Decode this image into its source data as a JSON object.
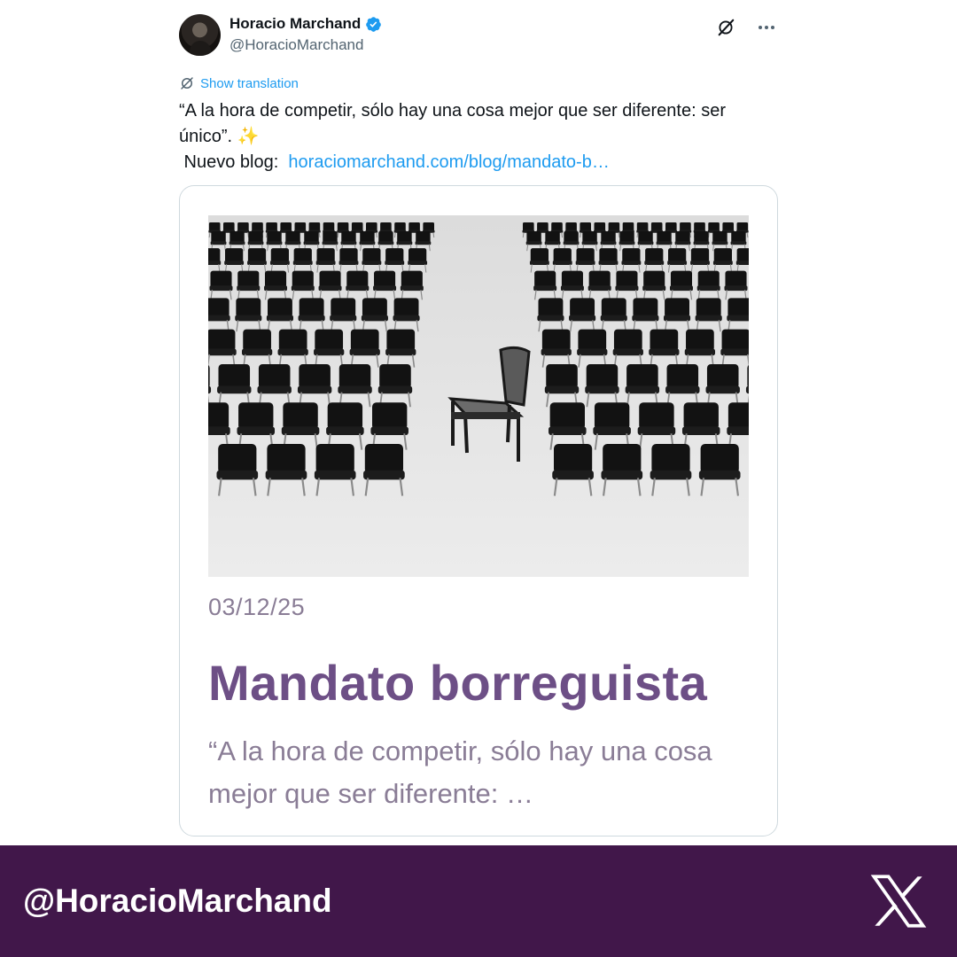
{
  "tweet": {
    "author_name": "Horacio Marchand",
    "author_handle": "@HoracioMarchand",
    "show_translation": "Show translation",
    "text_line1": "“A la hora de competir, sólo hay una cosa mejor que ser diferente: ser único”. ✨",
    "text_prefix": " Nuevo blog:  ",
    "link": "horaciomarchand.com/blog/mandato-b…"
  },
  "card": {
    "date": "03/12/25",
    "title": "Mandato borreguista",
    "excerpt": " “A la hora de competir, sólo hay una cosa mejor que ser diferente: …"
  },
  "footer": {
    "handle": "@HoracioMarchand"
  },
  "icons": {
    "verified": "verified-badge-icon",
    "grok": "grok-icon",
    "more": "more-icon",
    "translate": "translate-icon",
    "x_logo": "x-logo-icon"
  },
  "colors": {
    "link": "#1d9bf0",
    "title": "#6d4f86",
    "footer_bg": "#41174a"
  }
}
